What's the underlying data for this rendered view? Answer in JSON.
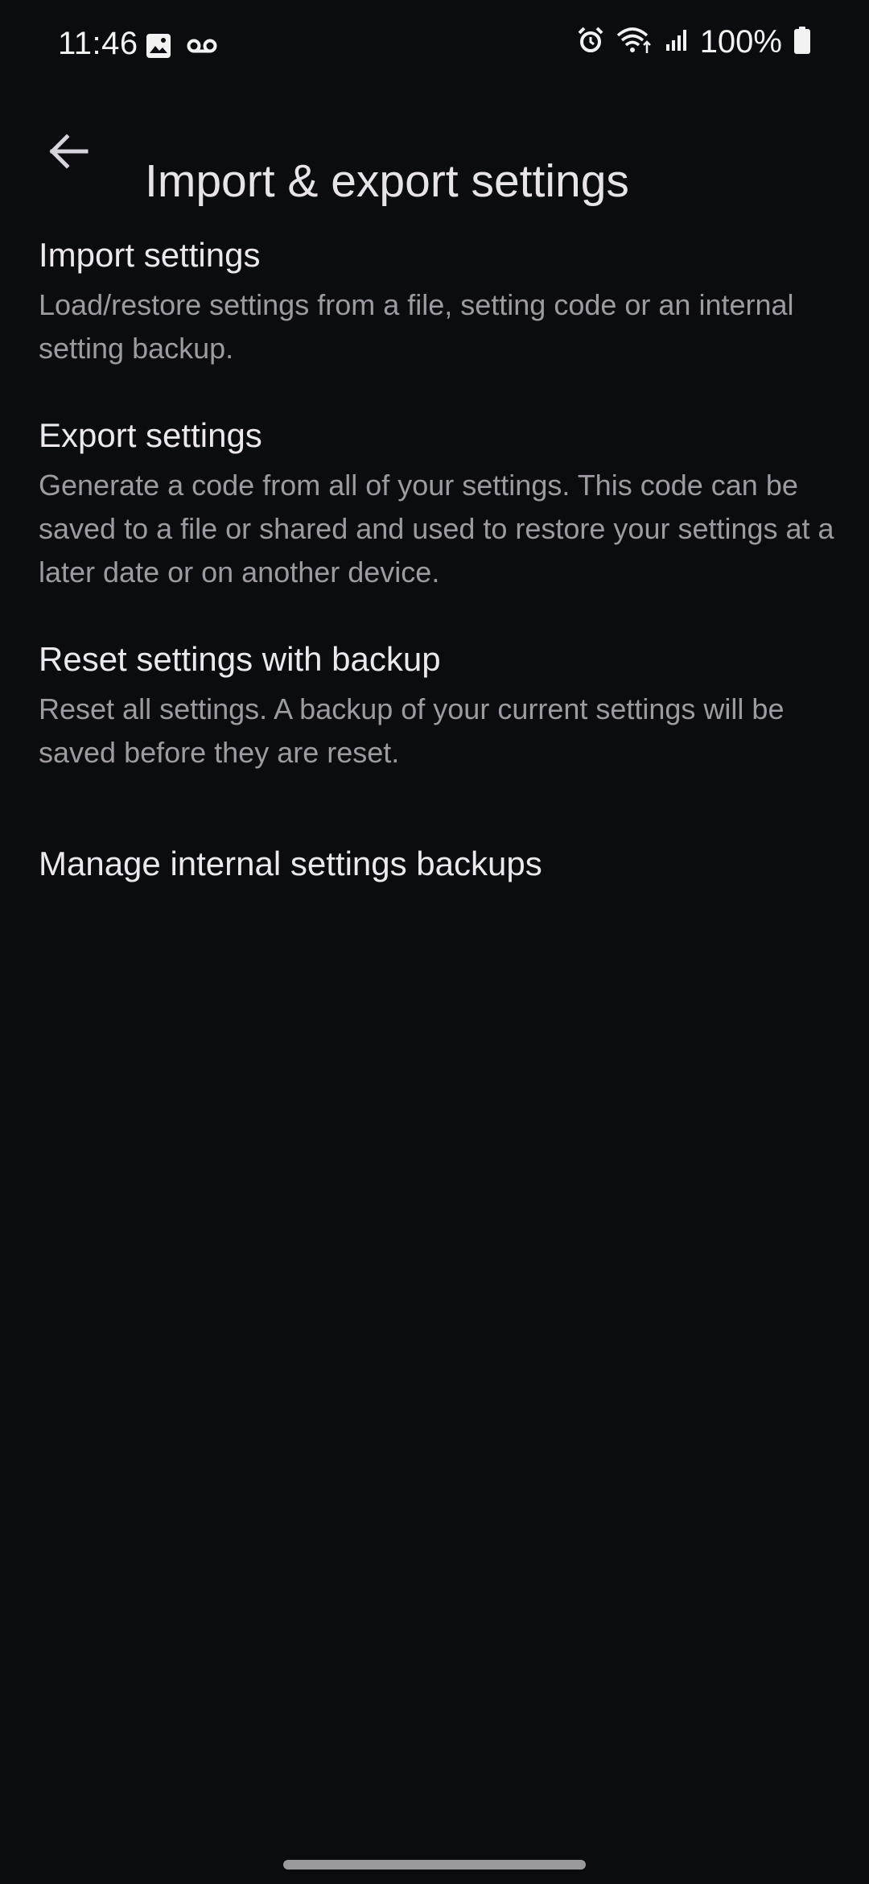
{
  "status_bar": {
    "time": "11:46",
    "battery_percent": "100%",
    "left_icons": [
      "gallery-icon",
      "voicemail-icon"
    ],
    "right_icons": [
      "alarm-icon",
      "wifi-icon",
      "signal-icon",
      "battery-icon"
    ]
  },
  "app_bar": {
    "title": "Import & export settings",
    "back_icon": "arrow-back-icon"
  },
  "settings": {
    "items": [
      {
        "title": "Import settings",
        "summary": "Load/restore settings from a file, setting code or an internal setting backup."
      },
      {
        "title": "Export settings",
        "summary": "Generate a code from all of your settings. This code can be saved to a file or shared and used to restore your settings at a later date or on another device."
      },
      {
        "title": "Reset settings with backup",
        "summary": "Reset all settings. A backup of your current settings will be saved before they are reset."
      },
      {
        "title": "Manage internal settings backups"
      }
    ]
  },
  "colors": {
    "background": "#0b0c0f",
    "title_text": "#ebe8ef",
    "summary_text": "#9d9aa3"
  }
}
